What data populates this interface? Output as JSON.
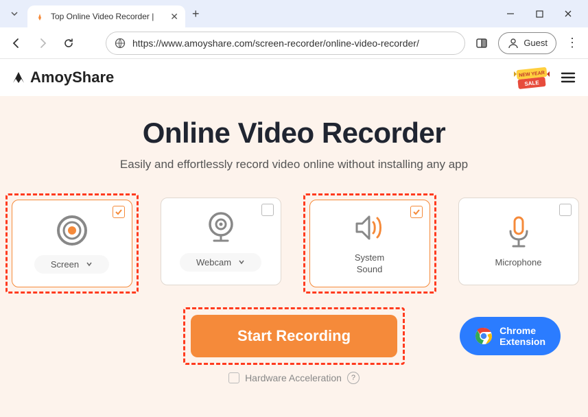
{
  "browser": {
    "tab_title": "Top Online Video Recorder |",
    "url": "https://www.amoyshare.com/screen-recorder/online-video-recorder/",
    "guest_label": "Guest"
  },
  "header": {
    "brand": "AmoyShare",
    "sale_top": "NEW YEAR",
    "sale_bottom": "SALE"
  },
  "main": {
    "title": "Online Video Recorder",
    "subtitle": "Easily and effortlessly record video online without installing any app",
    "cards": [
      {
        "label": "Screen",
        "checked": true,
        "dropdown": true,
        "highlight": true
      },
      {
        "label": "Webcam",
        "checked": false,
        "dropdown": true,
        "highlight": false
      },
      {
        "label": "System Sound",
        "checked": true,
        "dropdown": false,
        "highlight": true
      },
      {
        "label": "Microphone",
        "checked": false,
        "dropdown": false,
        "highlight": false
      }
    ],
    "start_label": "Start Recording",
    "extension_line1": "Chrome",
    "extension_line2": "Extension",
    "hw_label": "Hardware Acceleration"
  }
}
